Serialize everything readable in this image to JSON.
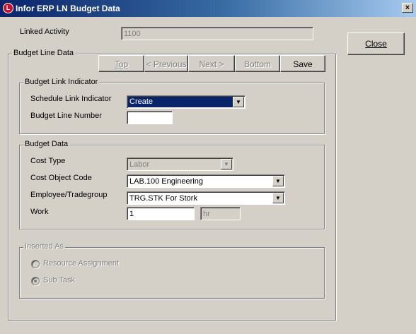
{
  "window": {
    "title": "Infor ERP LN Budget Data",
    "icon_letter": "L",
    "close_glyph": "×"
  },
  "linked_activity": {
    "label": "Linked Activity",
    "value": "1100"
  },
  "close_button": {
    "label": "Close"
  },
  "budget_line_data": {
    "legend": "Budget Line Data",
    "nav": {
      "top": "Top",
      "previous": "< Previous",
      "next": "Next >",
      "bottom": "Bottom",
      "save": "Save"
    }
  },
  "budget_link_indicator": {
    "legend": "Budget Link Indicator",
    "schedule_link_label": "Schedule Link Indicator",
    "schedule_link_value": "Create",
    "budget_line_number_label": "Budget Line Number",
    "budget_line_number_value": ""
  },
  "budget_data": {
    "legend": "Budget Data",
    "cost_type_label": "Cost Type",
    "cost_type_value": "Labor",
    "cost_object_code_label": "Cost Object Code",
    "cost_object_code_value": "LAB.100 Engineering",
    "employee_label": "Employee/Tradegroup",
    "employee_value": "TRG.STK For Stork",
    "work_label": "Work",
    "work_value": "1",
    "work_unit": "hr"
  },
  "inserted_as": {
    "legend": "Inserted As",
    "options": [
      {
        "label": "Resource Assignment",
        "selected": false
      },
      {
        "label": "Sub Task",
        "selected": true
      }
    ]
  },
  "icons": {
    "dropdown": "▼"
  },
  "colors": {
    "title_bar_start": "#0a246a",
    "title_bar_end": "#a6caf0",
    "selection": "#0a246a",
    "face": "#d4d0c8"
  }
}
